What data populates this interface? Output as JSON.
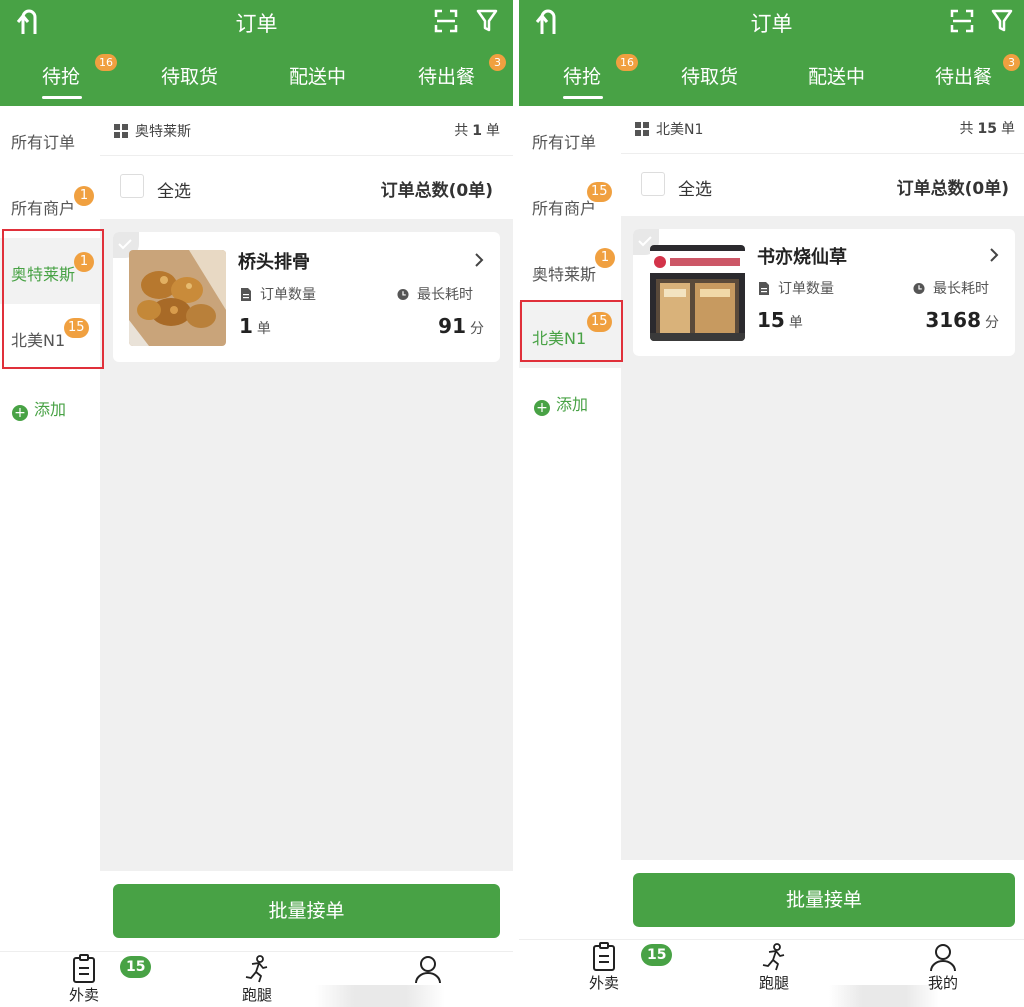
{
  "colors": {
    "brand": "#48a245",
    "badge": "#f0a040",
    "highlight": "#e0303a"
  },
  "screens": [
    {
      "header": {
        "title": "订单",
        "tabs": [
          {
            "label": "待抢",
            "badge": "16",
            "active": true
          },
          {
            "label": "待取货"
          },
          {
            "label": "配送中"
          },
          {
            "label": "待出餐",
            "badge": "3"
          }
        ]
      },
      "sidebar": {
        "items": [
          {
            "label": "所有订单"
          },
          {
            "label": "所有商户",
            "badge": "1"
          },
          {
            "label": "奥特莱斯",
            "badge": "1",
            "active": true
          },
          {
            "label": "北美N1",
            "badge": "15"
          }
        ],
        "add_label": "添加"
      },
      "shop_bar": {
        "name": "奥特莱斯",
        "count_prefix": "共",
        "count": "1",
        "count_suffix": "单"
      },
      "select_bar": {
        "select_all": "全选",
        "total": "订单总数(0单)"
      },
      "card": {
        "title": "桥头排骨",
        "order_count_label": "订单数量",
        "order_count": "1",
        "order_unit": "单",
        "max_time_label": "最长耗时",
        "max_time": "91",
        "time_unit": "分",
        "image": "fried-ribs-photo"
      },
      "batch_button": "批量接单",
      "nav": [
        {
          "label": "外卖",
          "icon": "clipboard-icon"
        },
        {
          "label": "跑腿",
          "icon": "runner-icon"
        },
        {
          "label": "",
          "icon": "user-icon"
        }
      ],
      "nav_badge": "15"
    },
    {
      "header": {
        "title": "订单",
        "tabs": [
          {
            "label": "待抢",
            "badge": "16",
            "active": true
          },
          {
            "label": "待取货"
          },
          {
            "label": "配送中"
          },
          {
            "label": "待出餐",
            "badge": "3"
          }
        ]
      },
      "sidebar": {
        "items": [
          {
            "label": "所有订单"
          },
          {
            "label": "所有商户",
            "badge": "15"
          },
          {
            "label": "奥特莱斯",
            "badge": "1"
          },
          {
            "label": "北美N1",
            "badge": "15",
            "active": true
          }
        ],
        "add_label": "添加"
      },
      "shop_bar": {
        "name": "北美N1",
        "count_prefix": "共",
        "count": "15",
        "count_suffix": "单"
      },
      "select_bar": {
        "select_all": "全选",
        "total": "订单总数(0单)"
      },
      "card": {
        "title": "书亦烧仙草",
        "order_count_label": "订单数量",
        "order_count": "15",
        "order_unit": "单",
        "max_time_label": "最长耗时",
        "max_time": "3168",
        "time_unit": "分",
        "image": "storefront-photo",
        "sign_text": "书亦烧仙草"
      },
      "batch_button": "批量接单",
      "nav": [
        {
          "label": "外卖",
          "icon": "clipboard-icon"
        },
        {
          "label": "跑腿",
          "icon": "runner-icon"
        },
        {
          "label": "我的",
          "icon": "user-icon"
        }
      ],
      "nav_badge": "15"
    }
  ]
}
